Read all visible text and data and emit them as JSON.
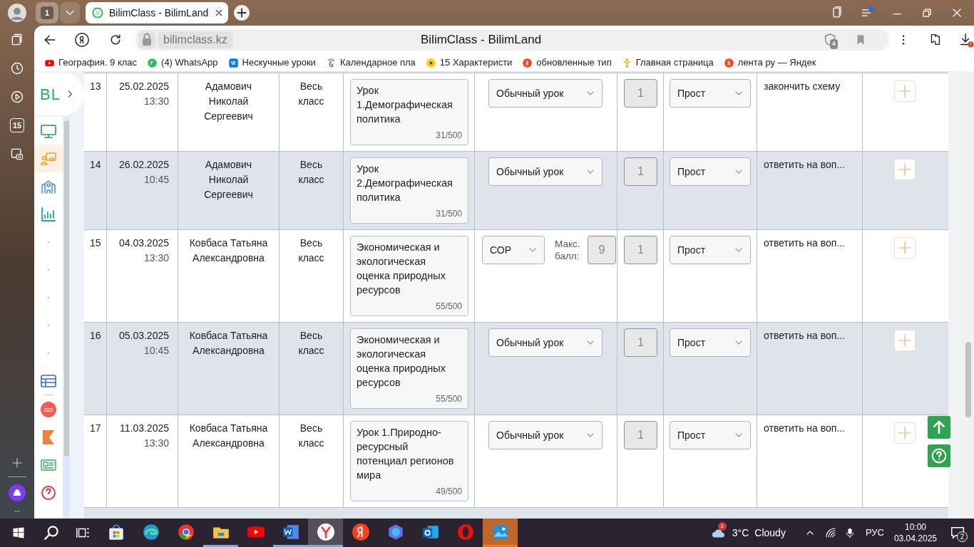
{
  "browser": {
    "tab_group_count": "1",
    "tab": {
      "title": "BilimClass - BilimLand",
      "selected": true
    },
    "address": "bilimclass.kz",
    "page_title": "BilimClass - BilimLand",
    "shield_badge": "4",
    "bookmarks": [
      {
        "kind": "youtube",
        "label": "География. 9 клас"
      },
      {
        "kind": "whatsapp",
        "label": "(4) WhatsApp"
      },
      {
        "kind": "vk",
        "label": "Нескучные уроки"
      },
      {
        "kind": "calendar",
        "label": "Календарное пла"
      },
      {
        "kind": "play",
        "label": "15 Характеристи"
      },
      {
        "kind": "yandex",
        "label": "обновленные тип"
      },
      {
        "kind": "person",
        "label": "Главная страница"
      },
      {
        "kind": "yandex",
        "label": "лента ру — Яндек"
      }
    ],
    "rail_calendar_day": "15"
  },
  "site": {
    "logo": "BL",
    "nav": [
      {
        "kind": "monitor",
        "selected": false
      },
      {
        "kind": "lessons",
        "selected": true
      },
      {
        "kind": "school",
        "selected": false
      },
      {
        "kind": "chart",
        "selected": false
      },
      {
        "kind": "dot",
        "selected": false
      },
      {
        "kind": "dot",
        "selected": false
      },
      {
        "kind": "dot",
        "selected": false
      },
      {
        "kind": "dot",
        "selected": false
      },
      {
        "kind": "dot",
        "selected": false
      },
      {
        "kind": "table",
        "selected": false
      },
      {
        "kind": "bilim",
        "selected": false
      },
      {
        "kind": "k",
        "selected": false
      },
      {
        "kind": "news",
        "selected": false
      },
      {
        "kind": "help",
        "selected": false
      }
    ]
  },
  "table": {
    "rows": [
      {
        "num": "13",
        "date": "25.02.2025",
        "time": "13:30",
        "teacher": "Адамович Николай Сергеевич",
        "class": "Весь класс",
        "topic": "Урок 1.Демографическая политика",
        "topic_count": "31/500",
        "lesson_type": {
          "kind": "plain",
          "value": "Обычный урок"
        },
        "hours": "1",
        "difficulty": "Прост",
        "homework": "закончить схему"
      },
      {
        "num": "14",
        "date": "26.02.2025",
        "time": "10:45",
        "teacher": "Адамович Николай Сергеевич",
        "class": "Весь класс",
        "topic": "Урок 2.Демографическая политика",
        "topic_count": "31/500",
        "lesson_type": {
          "kind": "plain",
          "value": "Обычный урок"
        },
        "hours": "1",
        "difficulty": "Прост",
        "homework": "ответить на воп..."
      },
      {
        "num": "15",
        "date": "04.03.2025",
        "time": "13:30",
        "teacher": "Ковбаса Татьяна Александровна",
        "class": "Весь класс",
        "topic": "Экономическая и экологическая оценка природных ресурсов",
        "topic_count": "55/500",
        "lesson_type": {
          "kind": "sor",
          "value": "СОР",
          "max_label": "Макс. балл:",
          "max_score": "9"
        },
        "hours": "1",
        "difficulty": "Прост",
        "homework": "ответить на воп..."
      },
      {
        "num": "16",
        "date": "05.03.2025",
        "time": "10:45",
        "teacher": "Ковбаса Татьяна Александровна",
        "class": "Весь класс",
        "topic": "Экономическая и экологическая оценка природных ресурсов",
        "topic_count": "55/500",
        "lesson_type": {
          "kind": "plain",
          "value": "Обычный урок"
        },
        "hours": "1",
        "difficulty": "Прост",
        "homework": "ответить на воп..."
      },
      {
        "num": "17",
        "date": "11.03.2025",
        "time": "13:30",
        "teacher": "Ковбаса Татьяна Александровна",
        "class": "Весь класс",
        "topic": "Урок 1.Природно-ресурсный потенциал регионов мира",
        "topic_count": "49/500",
        "lesson_type": {
          "kind": "plain",
          "value": "Обычный урок"
        },
        "hours": "1",
        "difficulty": "Прост",
        "homework": "ответить на воп..."
      }
    ]
  },
  "taskbar": {
    "apps": [
      {
        "kind": "store",
        "running": false,
        "focused": false,
        "flashing": false
      },
      {
        "kind": "edge",
        "running": false,
        "focused": false,
        "flashing": false
      },
      {
        "kind": "chrome",
        "running": false,
        "focused": false,
        "flashing": false
      },
      {
        "kind": "folder",
        "running": true,
        "focused": false,
        "flashing": false
      },
      {
        "kind": "youtube",
        "running": false,
        "focused": false,
        "flashing": false
      },
      {
        "kind": "word",
        "running": true,
        "focused": false,
        "flashing": false
      },
      {
        "kind": "yandex-browser",
        "running": true,
        "focused": true,
        "flashing": false
      },
      {
        "kind": "yandex",
        "running": false,
        "focused": false,
        "flashing": false
      },
      {
        "kind": "copilot",
        "running": false,
        "focused": false,
        "flashing": false
      },
      {
        "kind": "outlook",
        "running": false,
        "focused": false,
        "flashing": false
      },
      {
        "kind": "opera",
        "running": false,
        "focused": false,
        "flashing": false
      },
      {
        "kind": "photos",
        "running": true,
        "focused": false,
        "flashing": true
      }
    ],
    "weather_badge": "1",
    "temperature": "3°C",
    "weather": "Cloudy",
    "language": "РУС",
    "time": "10:00",
    "date": "03.04.2025",
    "notifications": "2"
  }
}
